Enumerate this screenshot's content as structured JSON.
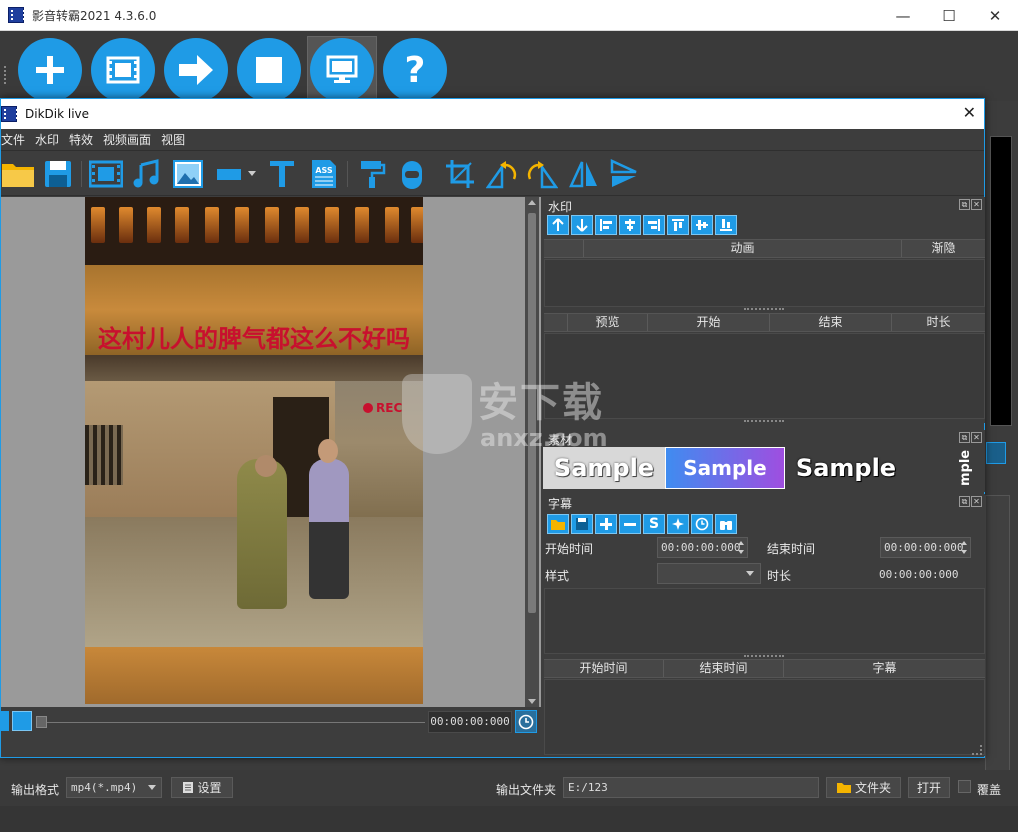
{
  "main_window": {
    "title": "影音转霸2021 4.3.6.0",
    "controls": {
      "minimize": "—",
      "maximize": "☐",
      "close": "✕"
    }
  },
  "main_toolbar": {
    "buttons": [
      {
        "name": "add",
        "icon": "plus-icon"
      },
      {
        "name": "video",
        "icon": "film-icon"
      },
      {
        "name": "convert",
        "icon": "arrow-right-icon"
      },
      {
        "name": "stop",
        "icon": "stop-icon"
      },
      {
        "name": "live",
        "icon": "monitor-icon",
        "active": true
      },
      {
        "name": "help",
        "icon": "question-icon",
        "label": "?"
      }
    ]
  },
  "dialog": {
    "title": "DikDik live",
    "close": "✕",
    "menu": [
      "文件",
      "水印",
      "特效",
      "视频画面",
      "视图"
    ],
    "toolbar_icons": [
      "folder-icon",
      "save-icon",
      "film-icon",
      "music-icon",
      "image-icon",
      "rectangle-icon",
      "dropdown-arrow-icon",
      "text-icon",
      "ass-subtitle-icon",
      "paint-roller-icon",
      "mask-icon",
      "crop-icon",
      "rotate-left-icon",
      "rotate-right-icon",
      "flip-horizontal-icon",
      "flip-vertical-icon"
    ],
    "ass_label": "ASS"
  },
  "preview": {
    "caption": "这村儿人的脾气都这么不好吗",
    "rec_label": "REC",
    "time": "00:00:00:000"
  },
  "watermark_panel": {
    "title": "水印",
    "tool_icons": [
      "arrow-up-icon",
      "arrow-down-icon",
      "align-left-icon",
      "align-center-icon",
      "align-right-icon",
      "align-top-icon",
      "align-middle-icon",
      "align-bottom-icon"
    ],
    "anim_headers": [
      "",
      "动画",
      "渐隐"
    ],
    "timeline_headers": [
      "",
      "预览",
      "开始",
      "结束",
      "时长"
    ]
  },
  "material_panel": {
    "title": "素材",
    "samples": [
      "Sample",
      "Sample",
      "Sample",
      "mple"
    ]
  },
  "subtitle_panel": {
    "title": "字幕",
    "tool_icons": [
      "folder-icon",
      "save-icon",
      "plus-icon",
      "minus-icon",
      "s-icon",
      "sparkle-icon",
      "clock-icon",
      "binoculars-icon"
    ],
    "start_label": "开始时间",
    "start_value": "00:00:00:000",
    "end_label": "结束时间",
    "end_value": "00:00:00:000",
    "style_label": "样式",
    "duration_label": "时长",
    "duration_value": "00:00:00:000",
    "list_headers": [
      "开始时间",
      "结束时间",
      "字幕"
    ]
  },
  "output": {
    "format_label": "输出格式",
    "format_value": "mp4(*.mp4)",
    "settings_button": "设置",
    "folder_label": "输出文件夹",
    "folder_value": "E:/123",
    "folder_button": "文件夹",
    "open_button": "打开",
    "overwrite_label": "覆盖"
  },
  "watermark_overlay": {
    "text": "安下载",
    "sub": "anxz.com"
  },
  "colors": {
    "accent": "#1f9be6",
    "background": "#3d3d3d",
    "caption_red": "#c8102e"
  }
}
